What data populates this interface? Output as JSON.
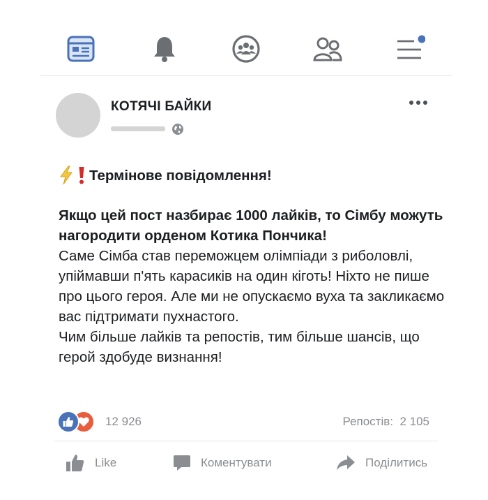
{
  "nav": {
    "items": [
      {
        "icon": "news-feed-icon"
      },
      {
        "icon": "bell-icon"
      },
      {
        "icon": "groups-icon"
      },
      {
        "icon": "friends-icon"
      },
      {
        "icon": "menu-icon",
        "badge": true
      }
    ]
  },
  "post": {
    "page_name": "КОТЯЧІ БАЙКИ",
    "urgent_title": "Термінове повідомлення!",
    "bold_text": "Якщо цей пост назбирає 1000 лайків, то Сімбу можуть нагородити орденом Котика Пончика!",
    "body_text": "Саме Сімба став переможцем олімпіади з риболовлі, упіймавши п'ять карасиків на один кіготь! Ніхто не пише про цього героя. Але ми не опускаємо вуха та закликаємо вас підтримати пухнастого.",
    "closing_text": "Чим більше лайків та репостів, тим більше шансів, що герой здобуде визнання!"
  },
  "stats": {
    "reactions_count": "12 926",
    "reposts_label": "Репостів:",
    "reposts_count": "2 105"
  },
  "actions": {
    "like_label": "Like",
    "comment_label": "Коментувати",
    "share_label": "Поділитись"
  },
  "colors": {
    "accent": "#4a72b8",
    "nav_icon": "#6b6e73",
    "love": "#e95c3d"
  }
}
